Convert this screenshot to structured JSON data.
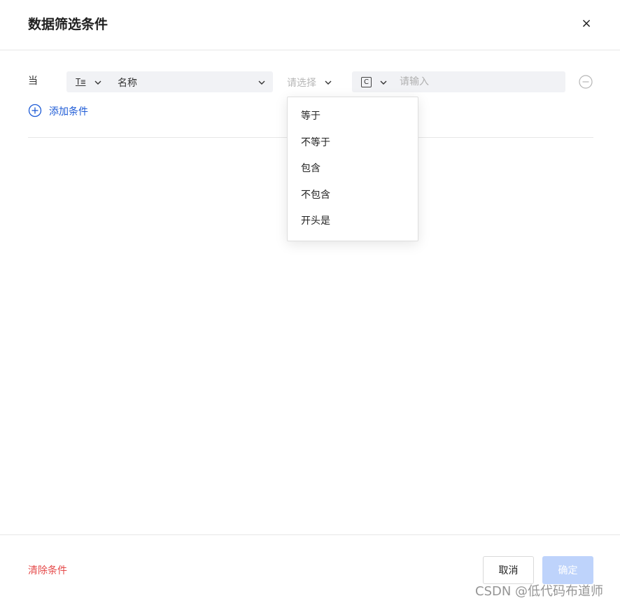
{
  "dialog": {
    "title": "数据筛选条件",
    "close_label": "×"
  },
  "condition": {
    "prefix": "当",
    "field": {
      "type_icon": "T≡",
      "name": "名称"
    },
    "operator": {
      "placeholder": "请选择"
    },
    "value": {
      "type_icon": "C",
      "placeholder": "请输入"
    }
  },
  "add_condition_label": "添加条件",
  "operator_options": [
    "等于",
    "不等于",
    "包含",
    "不包含",
    "开头是"
  ],
  "footer": {
    "clear_label": "清除条件",
    "cancel_label": "取消",
    "ok_label": "确定"
  },
  "watermark": "CSDN @低代码布道师",
  "colors": {
    "accent": "#1e5bd6",
    "danger": "#e54a4a",
    "primary_disabled": "#bed3fb"
  }
}
